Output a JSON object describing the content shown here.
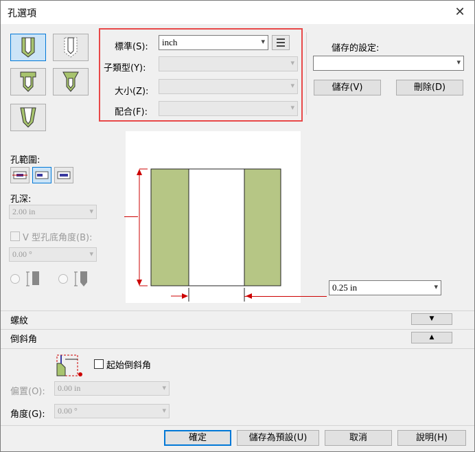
{
  "window": {
    "title": "孔選項",
    "close_glyph": "✕"
  },
  "standard": {
    "label": "標準(S):",
    "value": "inch"
  },
  "subtype": {
    "label": "子類型(Y):",
    "value": ""
  },
  "size": {
    "label": "大小(Z):",
    "value": ""
  },
  "fit": {
    "label": "配合(F):",
    "value": ""
  },
  "saved_settings": {
    "label": "儲存的設定:",
    "value": "",
    "save_button": "儲存(V)",
    "delete_button": "刪除(D)"
  },
  "hole_extent": {
    "label": "孔範圍:"
  },
  "hole_depth": {
    "label": "孔深:",
    "value": "2.00 in"
  },
  "v_angle": {
    "label": "V 型孔底角度(B):",
    "value": "0.00 °"
  },
  "preview": {
    "diameter_value": "0.25 in"
  },
  "thread_section": {
    "label": "螺紋",
    "toggle": "▼"
  },
  "chamfer_section": {
    "label": "倒斜角",
    "toggle": "▲",
    "start_label": "起始倒斜角",
    "offset_label": "偏置(O):",
    "offset_value": "0.00 in",
    "angle_label": "角度(G):",
    "angle_value": "0.00 °"
  },
  "buttons": {
    "ok": "確定",
    "save_default": "儲存為預設(U)",
    "cancel": "取消",
    "help": "說明(H)"
  }
}
